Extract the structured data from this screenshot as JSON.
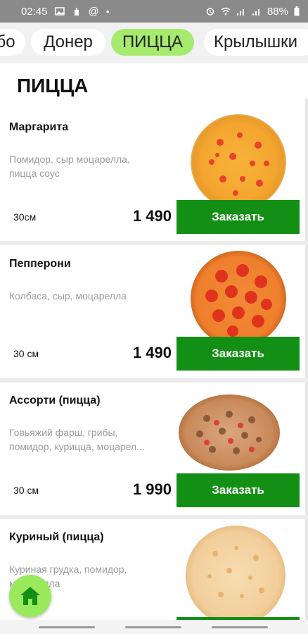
{
  "status_bar": {
    "time": "02:45",
    "battery": "88%",
    "icons": [
      "image-icon",
      "hand-icon",
      "at-icon",
      "dot-icon",
      "alarm-icon",
      "wifi-icon",
      "signal-icon",
      "signal-icon",
      "battery-icon"
    ]
  },
  "tabs": [
    {
      "label": "бо",
      "active": false
    },
    {
      "label": "Донер",
      "active": false
    },
    {
      "label": "ПИЦЦА",
      "active": true
    },
    {
      "label": "Крылышки",
      "active": false
    }
  ],
  "section_title": "ПИЦЦА",
  "products": [
    {
      "name": "Маргарита",
      "description": "Помидор, сыр моцарелла,\nпицца соус",
      "size": "30см",
      "price": "1 490",
      "order_label": "Заказать",
      "image": "margherita-pizza"
    },
    {
      "name": "Пепперони",
      "description": "Колбаса, сыр, моцарелла",
      "size": "30 см",
      "price": "1 490",
      "order_label": "Заказать",
      "image": "pepperoni-pizza"
    },
    {
      "name": "Ассорти (пицца)",
      "description": "Говьяжий фарш, грибы,\nпомидор, курицца, моцарел...",
      "size": "30 см",
      "price": "1 990",
      "order_label": "Заказать",
      "image": "assorti-pizza"
    },
    {
      "name": "Куриный (пицца)",
      "description": "Куриная грудка, помидор,\nмоцарелла",
      "size": "",
      "price": "",
      "order_label": "",
      "image": "chicken-pizza"
    }
  ],
  "colors": {
    "accent_green": "#138f16",
    "active_tab": "#a6ea6e",
    "home_button": "#9ae85c"
  }
}
